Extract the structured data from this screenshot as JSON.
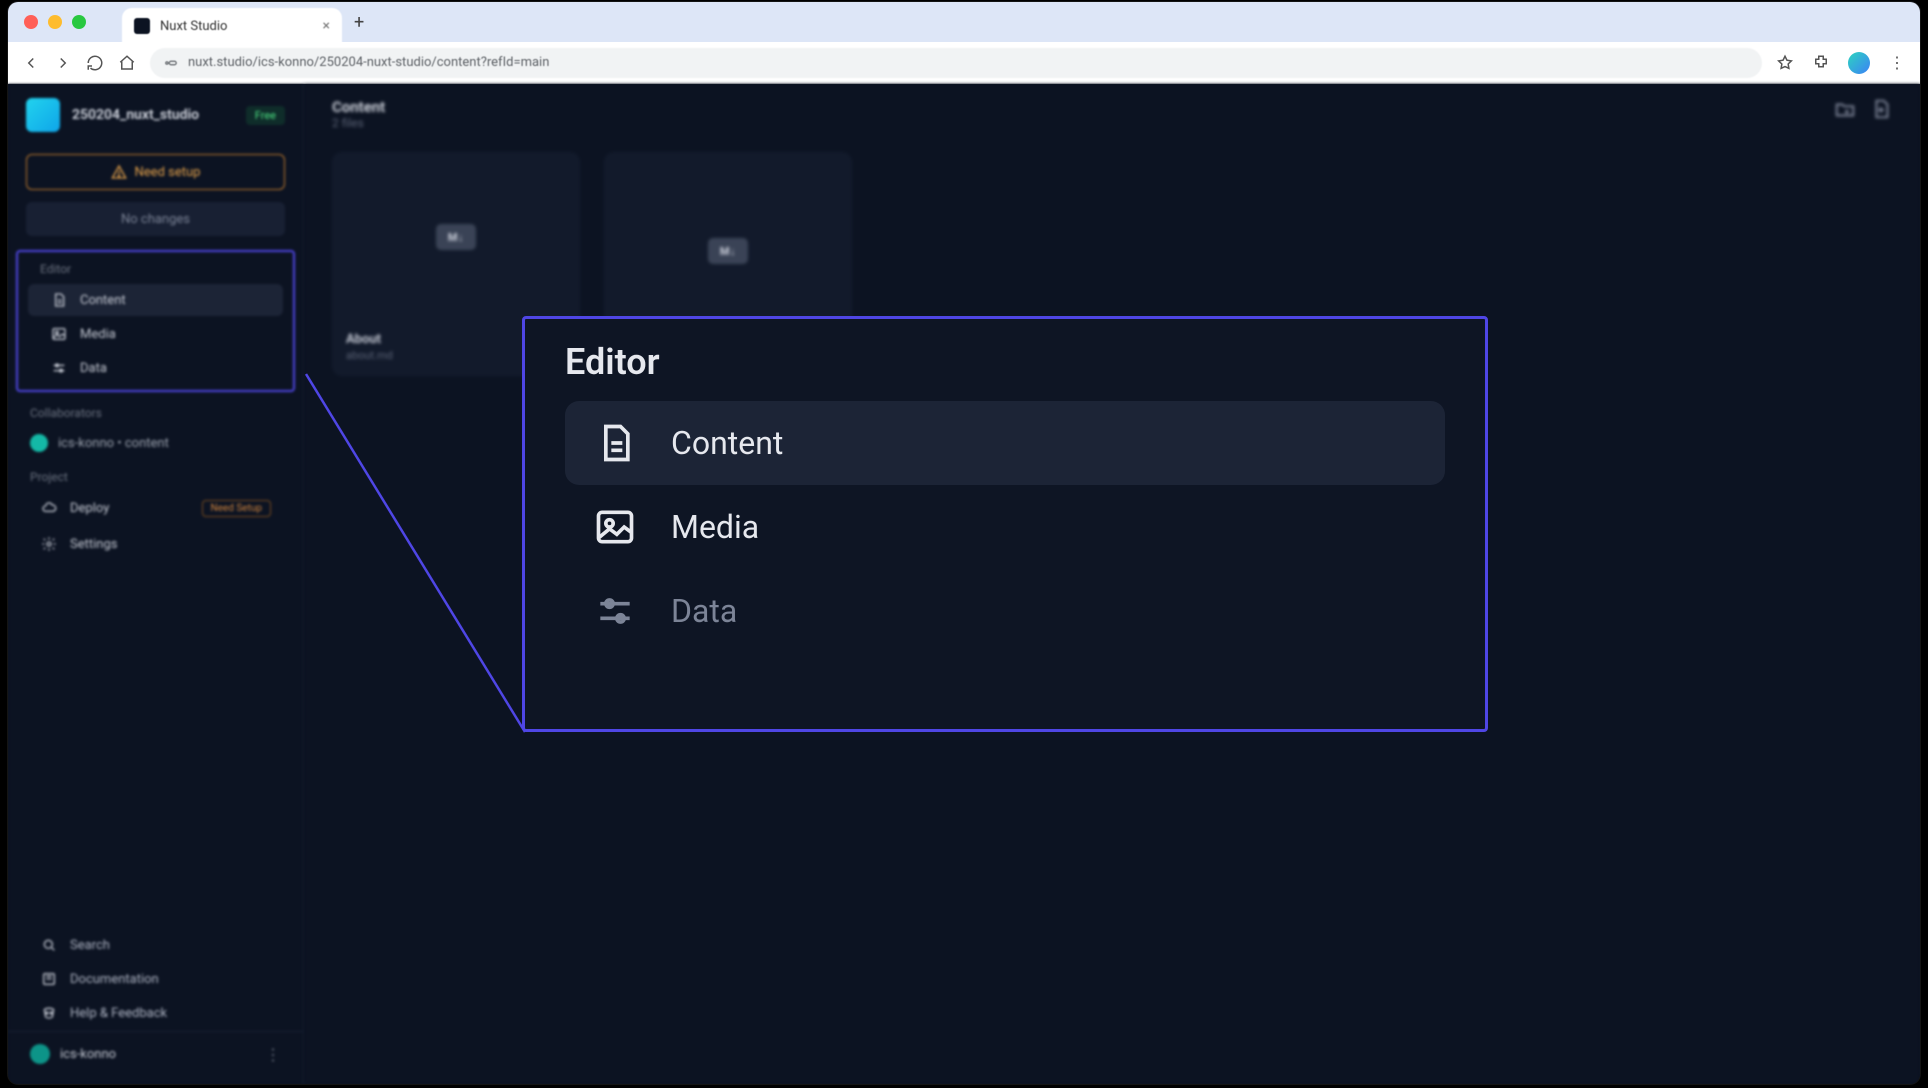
{
  "browser": {
    "tab_title": "Nuxt Studio",
    "url": "nuxt.studio/ics-konno/250204-nuxt-studio/content?refId=main"
  },
  "sidebar": {
    "project_name": "250204_nuxt_studio",
    "free_badge": "Free",
    "need_setup_btn": "Need setup",
    "no_changes_btn": "No changes",
    "editor_label": "Editor",
    "items": {
      "content": "Content",
      "media": "Media",
      "data": "Data"
    },
    "collaborators_label": "Collaborators",
    "collaborator": "ics-konno • content",
    "project_label": "Project",
    "deploy": "Deploy",
    "need_setup_pill": "Need Setup",
    "settings": "Settings",
    "bottom": {
      "search": "Search",
      "documentation": "Documentation",
      "help": "Help & Feedback"
    },
    "user": "ics-konno"
  },
  "main": {
    "title": "Content",
    "subtitle": "2 files",
    "card_md": "M↓",
    "card1": {
      "title": "About",
      "file": "about.md",
      "time": "⊙"
    },
    "card2": {
      "title": "",
      "file": "",
      "time": ""
    }
  },
  "callout": {
    "heading": "Editor",
    "content": "Content",
    "media": "Media",
    "data": "Data"
  }
}
